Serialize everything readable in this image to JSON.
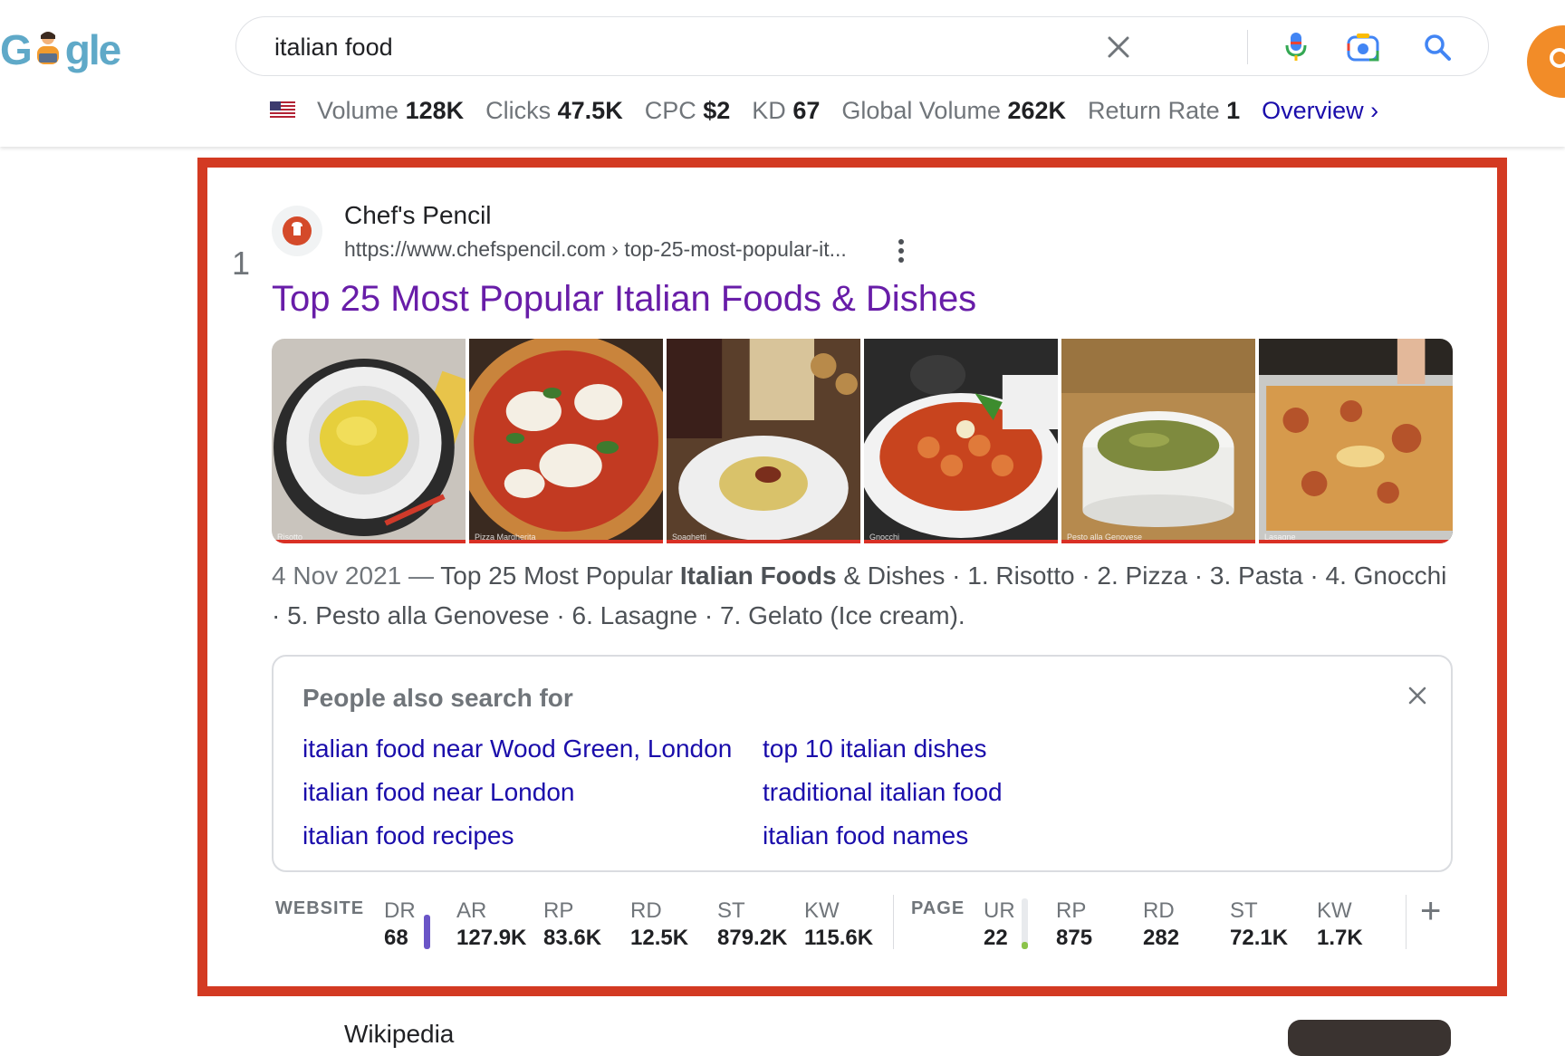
{
  "search": {
    "query": "italian food"
  },
  "logo": {
    "first_letter": "G",
    "rest": "gle"
  },
  "metrics": [
    {
      "label": "Volume",
      "value": "128K"
    },
    {
      "label": "Clicks",
      "value": "47.5K"
    },
    {
      "label": "CPC",
      "value": "$2"
    },
    {
      "label": "KD",
      "value": "67"
    },
    {
      "label": "Global Volume",
      "value": "262K"
    },
    {
      "label": "Return Rate",
      "value": "1"
    }
  ],
  "overview_link": "Overview ›",
  "result": {
    "rank": "1",
    "site_name": "Chef's Pencil",
    "url": "https://www.chefspencil.com › top-25-most-popular-it...",
    "title": "Top 25 Most Popular Italian Foods & Dishes",
    "thumbnails": [
      {
        "icon": "risotto-image",
        "caption": "Risotto"
      },
      {
        "icon": "pizza-image",
        "caption": "Pizza Margherita"
      },
      {
        "icon": "pasta-image",
        "caption": "Spaghetti"
      },
      {
        "icon": "gnocchi-image",
        "caption": "Gnocchi"
      },
      {
        "icon": "pesto-image",
        "caption": "Pesto alla Genovese"
      },
      {
        "icon": "lasagne-image",
        "caption": "Lasagne"
      }
    ],
    "snippet": {
      "date": "4 Nov 2021 —",
      "part1": " Top 25 Most Popular ",
      "bold": "Italian Foods",
      "part2": " & Dishes · 1. Risotto · 2. Pizza · 3. Pasta · 4. Gnocchi · 5. Pesto alla Genovese · 6. Lasagne · 7. Gelato (Ice cream)."
    }
  },
  "people_also_search": {
    "title": "People also search for",
    "links": [
      "italian food near Wood Green, London",
      "top 10 italian dishes",
      "italian food near London",
      "traditional italian food",
      "italian food recipes",
      "italian food names"
    ]
  },
  "stats": {
    "website_label": "WEBSITE",
    "page_label": "PAGE",
    "website": [
      {
        "key": "DR",
        "value": "68"
      },
      {
        "key": "AR",
        "value": "127.9K"
      },
      {
        "key": "RP",
        "value": "83.6K"
      },
      {
        "key": "RD",
        "value": "12.5K"
      },
      {
        "key": "ST",
        "value": "879.2K"
      },
      {
        "key": "KW",
        "value": "115.6K"
      }
    ],
    "page": [
      {
        "key": "UR",
        "value": "22"
      },
      {
        "key": "RP",
        "value": "875"
      },
      {
        "key": "RD",
        "value": "282"
      },
      {
        "key": "ST",
        "value": "72.1K"
      },
      {
        "key": "KW",
        "value": "1.7K"
      }
    ],
    "dr_level": 0.68,
    "ur_level": 0.22,
    "plus_label": "+"
  },
  "next_result": {
    "site_name": "Wikipedia"
  },
  "colors": {
    "frame": "#d33a22",
    "link": "#1a0dab",
    "visited": "#681da8",
    "dr_bar": "#6a55c7",
    "ur_bar": "#8bc34a",
    "accent_orange": "#f28c28"
  }
}
